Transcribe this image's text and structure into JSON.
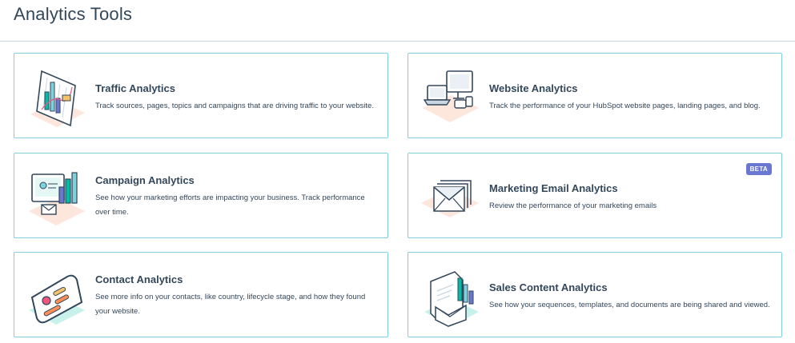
{
  "header": {
    "title": "Analytics Tools"
  },
  "cards": [
    {
      "title": "Traffic Analytics",
      "description": "Track sources, pages, topics and campaigns that are driving traffic to your website.",
      "icon": "traffic-chart-illustration-icon"
    },
    {
      "title": "Website Analytics",
      "description": "Track the performance of your HubSpot website pages, landing pages, and blog.",
      "icon": "devices-illustration-icon"
    },
    {
      "title": "Campaign Analytics",
      "description": "See how your marketing efforts are impacting your business. Track performance over time.",
      "icon": "campaign-dashboard-illustration-icon"
    },
    {
      "title": "Marketing Email Analytics",
      "description": "Review the performance of your marketing emails",
      "icon": "envelopes-illustration-icon",
      "badge": "BETA"
    },
    {
      "title": "Contact Analytics",
      "description": "See more info on your contacts, like country, lifecycle stage, and how they found your website.",
      "icon": "contact-card-illustration-icon"
    },
    {
      "title": "Sales Content Analytics",
      "description": "See how your sequences, templates, and documents are being shared and viewed.",
      "icon": "document-envelope-illustration-icon"
    }
  ],
  "colors": {
    "border": "#7fd1de",
    "text": "#33475b",
    "badge": "#6a78d1",
    "teal": "#00bda5",
    "peach": "#fde6dc"
  }
}
